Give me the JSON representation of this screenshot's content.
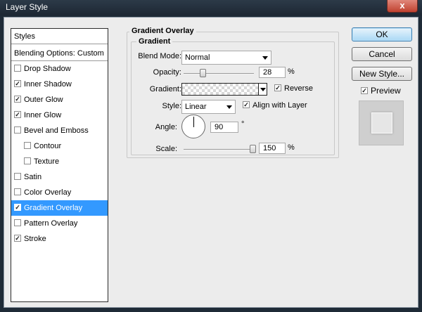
{
  "window": {
    "title": "Layer Style",
    "close_glyph": "x"
  },
  "styles_list": {
    "header": "Styles",
    "items": [
      {
        "label": "Blending Options: Custom",
        "checkbox": false,
        "checked": false
      },
      {
        "label": "Drop Shadow",
        "checkbox": true,
        "checked": false
      },
      {
        "label": "Inner Shadow",
        "checkbox": true,
        "checked": true
      },
      {
        "label": "Outer Glow",
        "checkbox": true,
        "checked": true
      },
      {
        "label": "Inner Glow",
        "checkbox": true,
        "checked": true
      },
      {
        "label": "Bevel and Emboss",
        "checkbox": true,
        "checked": false
      },
      {
        "label": "Contour",
        "checkbox": true,
        "checked": false
      },
      {
        "label": "Texture",
        "checkbox": true,
        "checked": false
      },
      {
        "label": "Satin",
        "checkbox": true,
        "checked": false
      },
      {
        "label": "Color Overlay",
        "checkbox": true,
        "checked": false
      },
      {
        "label": "Gradient Overlay",
        "checkbox": true,
        "checked": true
      },
      {
        "label": "Pattern Overlay",
        "checkbox": true,
        "checked": false
      },
      {
        "label": "Stroke",
        "checkbox": true,
        "checked": true
      }
    ]
  },
  "gradient_overlay": {
    "section_title": "Gradient Overlay",
    "group_title": "Gradient",
    "blend_mode": {
      "label": "Blend Mode:",
      "value": "Normal"
    },
    "opacity": {
      "label": "Opacity:",
      "value": "28",
      "unit": "%",
      "slider_fraction": 0.28
    },
    "gradient": {
      "label": "Gradient:"
    },
    "reverse": {
      "label": "Reverse",
      "checked": true
    },
    "style": {
      "label": "Style:",
      "value": "Linear"
    },
    "align_with_layer": {
      "label": "Align with Layer",
      "checked": true
    },
    "angle": {
      "label": "Angle:",
      "value": "90",
      "unit": "°"
    },
    "scale": {
      "label": "Scale:",
      "value": "150",
      "unit": "%",
      "slider_fraction": 1.0
    }
  },
  "buttons": {
    "ok": "OK",
    "cancel": "Cancel",
    "new_style": "New Style..."
  },
  "preview": {
    "label": "Preview",
    "checked": true
  },
  "colors": {
    "selection": "#3399ff",
    "dialog_bg": "#ececec",
    "title_bar": "#1d2733"
  }
}
